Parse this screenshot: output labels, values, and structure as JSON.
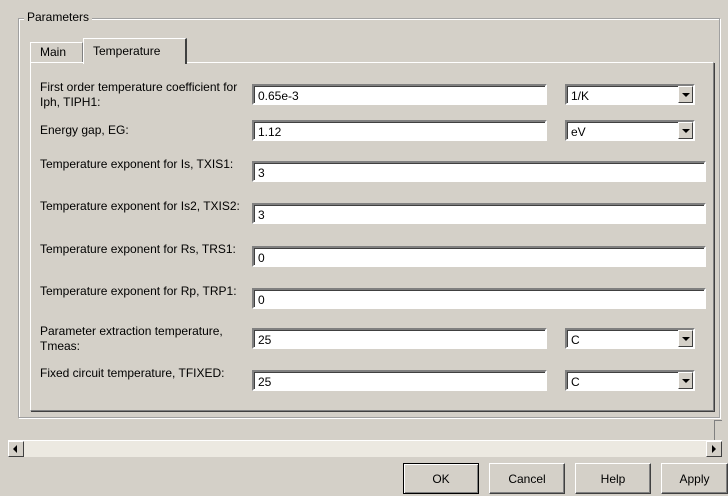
{
  "group": {
    "title": "Parameters"
  },
  "tabs": [
    {
      "label": "Main",
      "active": false
    },
    {
      "label": "Temperature",
      "active": true
    }
  ],
  "params": [
    {
      "label": "First order temperature coefficient for Iph, TIPH1:",
      "value": "0.65e-3",
      "unit": "1/K"
    },
    {
      "label": "Energy gap, EG:",
      "value": "1.12",
      "unit": "eV"
    },
    {
      "label": "Temperature exponent for Is, TXIS1:",
      "value": "3"
    },
    {
      "label": "Temperature exponent for Is2, TXIS2:",
      "value": "3"
    },
    {
      "label": "Temperature exponent for Rs, TRS1:",
      "value": "0"
    },
    {
      "label": "Temperature exponent for Rp, TRP1:",
      "value": "0"
    },
    {
      "label": "Parameter extraction temperature, Tmeas:",
      "value": "25",
      "unit": "C"
    },
    {
      "label": "Fixed circuit temperature, TFIXED:",
      "value": "25",
      "unit": "C"
    }
  ],
  "buttons": {
    "ok": "OK",
    "cancel": "Cancel",
    "help": "Help",
    "apply": "Apply"
  },
  "icons": {
    "dropdown": "chevron-down-icon",
    "scroll_left": "arrow-left-icon",
    "scroll_right": "arrow-right-icon"
  },
  "colors": {
    "background": "#d4d0c8",
    "field": "#ffffff"
  }
}
